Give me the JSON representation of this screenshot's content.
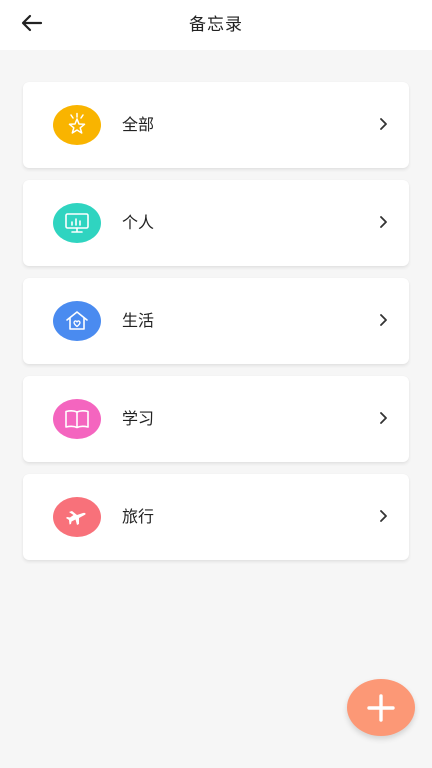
{
  "header": {
    "title": "备忘录",
    "back_icon": "arrow-left-icon"
  },
  "categories": [
    {
      "label": "全部",
      "icon": "star-icon",
      "color": "#f9b400"
    },
    {
      "label": "个人",
      "icon": "monitor-chart-icon",
      "color": "#2fd4c0"
    },
    {
      "label": "生活",
      "icon": "house-heart-icon",
      "color": "#4a8bf0"
    },
    {
      "label": "学习",
      "icon": "book-icon",
      "color": "#f465bf"
    },
    {
      "label": "旅行",
      "icon": "airplane-icon",
      "color": "#f8717a"
    }
  ],
  "fab": {
    "icon": "plus-icon",
    "color": "#fc9876"
  }
}
